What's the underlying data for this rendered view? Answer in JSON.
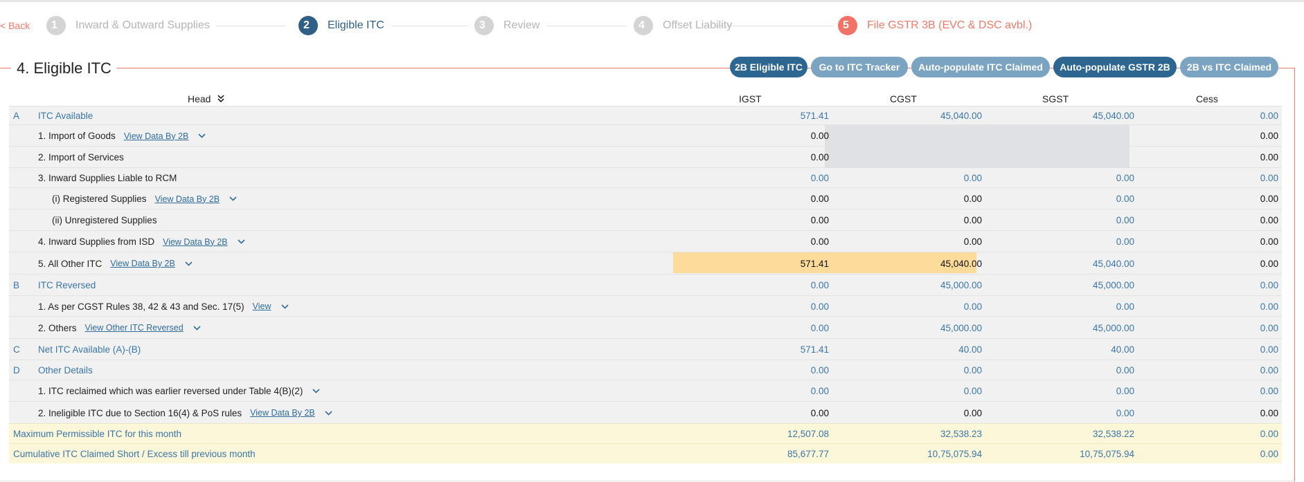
{
  "stepper": {
    "back": "< Back",
    "steps": [
      {
        "num": "1",
        "label": "Inward & Outward Supplies"
      },
      {
        "num": "2",
        "label": "Eligible ITC"
      },
      {
        "num": "3",
        "label": "Review"
      },
      {
        "num": "4",
        "label": "Offset Liability"
      },
      {
        "num": "5",
        "label": "File GSTR 3B (EVC & DSC avbl.)"
      }
    ]
  },
  "section": {
    "title": "4. Eligible ITC",
    "buttons": [
      "2B Eligible ITC",
      "Go to ITC Tracker",
      "Auto-populate ITC Claimed",
      "Auto-populate GSTR 2B",
      "2B vs ITC Claimed"
    ]
  },
  "table": {
    "headers": {
      "head": "Head",
      "igst": "IGST",
      "cgst": "CGST",
      "sgst": "SGST",
      "cess": "Cess"
    },
    "rows": [
      {
        "letter": "A",
        "label": "ITC Available",
        "igst": "571.41",
        "cgst": "45,040.00",
        "sgst": "45,040.00",
        "cess": "0.00"
      },
      {
        "label": "1.  Import of Goods",
        "link": "View Data By 2B",
        "igst": "0.00",
        "cess": "0.00"
      },
      {
        "label": "2.  Import of Services",
        "igst": "0.00",
        "cess": "0.00"
      },
      {
        "label": "3.  Inward Supplies Liable to RCM",
        "igst": "0.00",
        "cgst": "0.00",
        "sgst": "0.00",
        "cess": "0.00"
      },
      {
        "label": "(i) Registered Supplies",
        "link": "View Data By 2B",
        "igst": "0.00",
        "cgst": "0.00",
        "sgst": "0.00",
        "cess": "0.00"
      },
      {
        "label": "(ii) Unregistered Supplies",
        "igst": "0.00",
        "cgst": "0.00",
        "sgst": "0.00",
        "cess": "0.00"
      },
      {
        "label": "4.  Inward Supplies from ISD",
        "link": "View Data By 2B",
        "igst": "0.00",
        "cgst": "0.00",
        "sgst": "0.00",
        "cess": "0.00"
      },
      {
        "label": "5.  All Other ITC",
        "link": "View Data By 2B",
        "igst": "571.41",
        "cgst": "45,040.00",
        "sgst": "45,040.00",
        "cess": "0.00"
      },
      {
        "letter": "B",
        "label": "ITC Reversed",
        "igst": "0.00",
        "cgst": "45,000.00",
        "sgst": "45,000.00",
        "cess": "0.00"
      },
      {
        "label": "1.  As per CGST Rules 38, 42 & 43 and Sec. 17(5)",
        "link": "View",
        "igst": "0.00",
        "cgst": "0.00",
        "sgst": "0.00",
        "cess": "0.00"
      },
      {
        "label": "2.  Others",
        "link": "View Other ITC Reversed",
        "igst": "0.00",
        "cgst": "45,000.00",
        "sgst": "45,000.00",
        "cess": "0.00"
      },
      {
        "letter": "C",
        "label": "Net ITC Available (A)-(B)",
        "igst": "571.41",
        "cgst": "40.00",
        "sgst": "40.00",
        "cess": "0.00"
      },
      {
        "letter": "D",
        "label": "Other Details",
        "igst": "0.00",
        "cgst": "0.00",
        "sgst": "0.00",
        "cess": "0.00"
      },
      {
        "label": "1. ITC reclaimed which was earlier reversed under Table 4(B)(2)",
        "igst": "0.00",
        "cgst": "0.00",
        "sgst": "0.00",
        "cess": "0.00"
      },
      {
        "label": "2. Ineligible ITC due to Section 16(4) & PoS rules",
        "link": "View Data By 2B",
        "igst": "0.00",
        "cgst": "0.00",
        "sgst": "0.00",
        "cess": "0.00"
      },
      {
        "label": "Maximum Permissible ITC for this month",
        "igst": "12,507.08",
        "cgst": "32,538.23",
        "sgst": "32,538.22",
        "cess": "0.00"
      },
      {
        "label": "Cumulative ITC Claimed Short / Excess till previous month",
        "igst": "85,677.77",
        "cgst": "10,75,075.94",
        "sgst": "10,75,075.94",
        "cess": "0.00"
      }
    ]
  },
  "colors": {
    "accent": "#2f5f86",
    "file_step": "#f27366",
    "highlight": "#fddb9a",
    "summary_bg": "#fdf7d9"
  }
}
